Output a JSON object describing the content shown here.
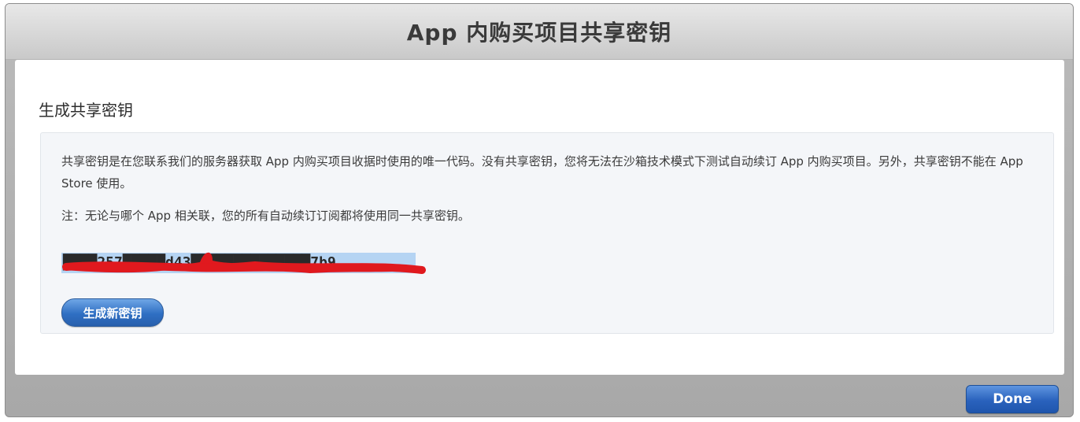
{
  "dialog": {
    "title": "App 内购买项目共享密钥",
    "section_title": "生成共享密钥",
    "description": "共享密钥是在您联系我们的服务器获取 App 内购买项目收据时使用的唯一代码。没有共享密钥，您将无法在沙箱技术模式下测试自动续订 App 内购买项目。另外，共享密钥不能在 App Store 使用。",
    "note": "注：无论与哪个 App 相关联，您的所有自动续订订阅都将使用同一共享密钥。",
    "secret_value": "████257█████d43██████████████7b9",
    "generate_button": "生成新密钥",
    "done_button": "Done"
  },
  "colors": {
    "accent": "#2f6fc3",
    "redaction": "#e0191e",
    "selection": "#b5d4f3"
  }
}
